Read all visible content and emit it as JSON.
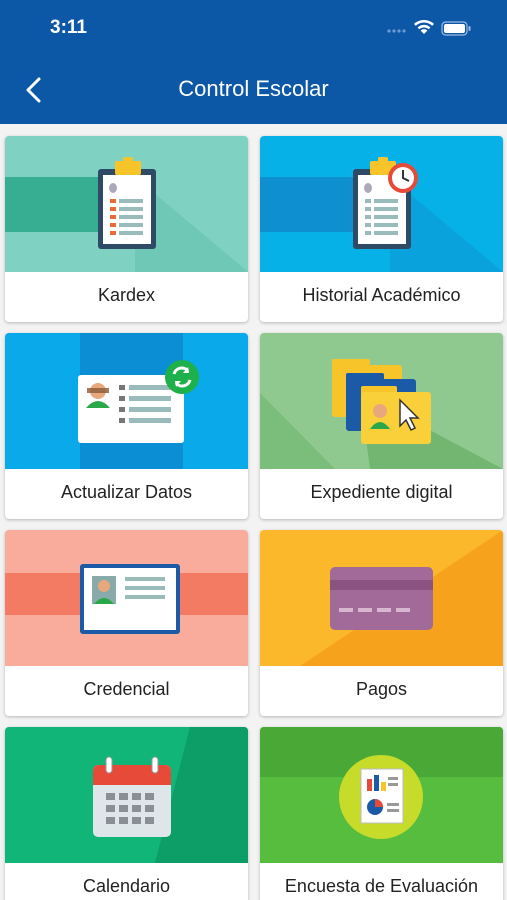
{
  "status_bar": {
    "time": "3:11"
  },
  "nav": {
    "title": "Control Escolar"
  },
  "tiles": [
    {
      "label": "Kardex"
    },
    {
      "label": "Historial Académico"
    },
    {
      "label": "Actualizar Datos"
    },
    {
      "label": "Expediente digital"
    },
    {
      "label": "Credencial"
    },
    {
      "label": "Pagos"
    },
    {
      "label": "Calendario"
    },
    {
      "label": "Encuesta de Evaluación"
    }
  ],
  "colors": {
    "header": "#0d57a7",
    "kardex": "#7fd1c1",
    "historial": "#06b1e8",
    "actualizar": "#0aa9ea",
    "expediente": "#8fc98f",
    "credencial": "#f9ab9c",
    "pagos": "#fbb82b",
    "calendario": "#10b577",
    "encuesta": "#57bd3e"
  }
}
